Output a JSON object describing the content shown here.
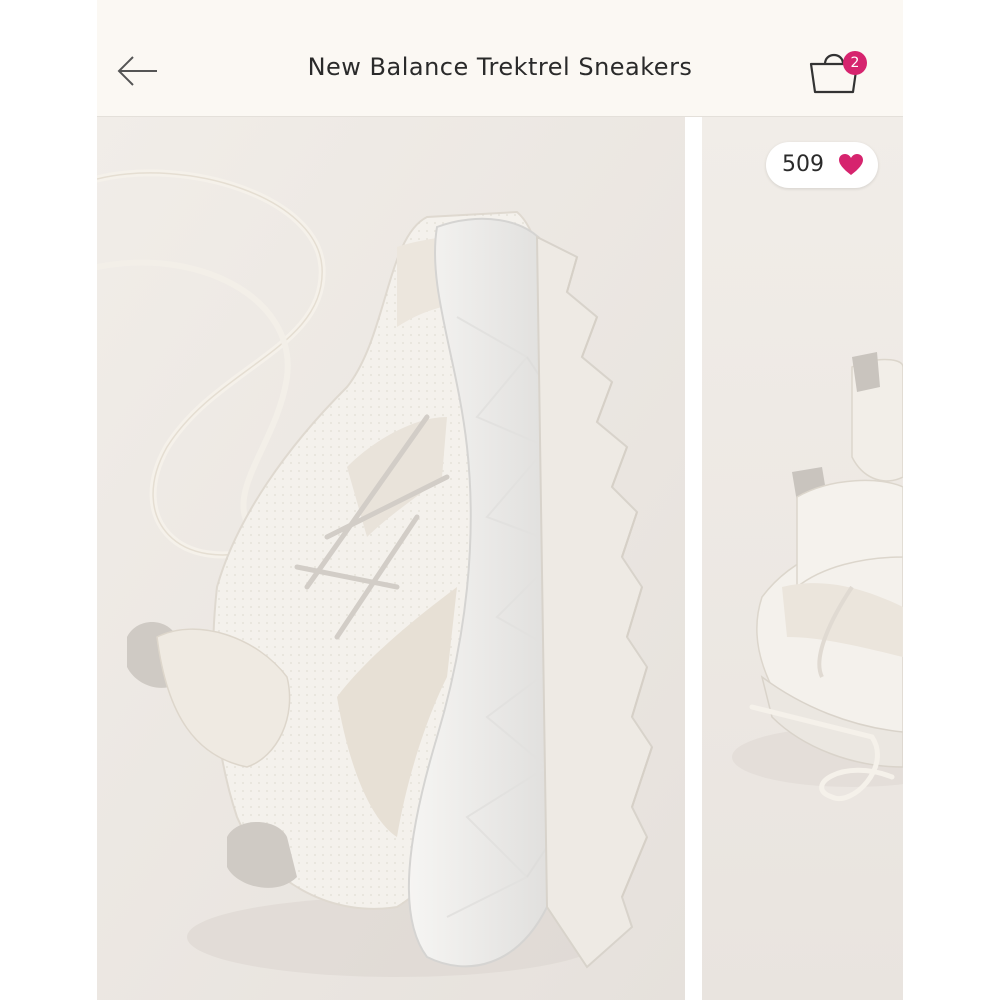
{
  "header": {
    "title": "New Balance Trektrel Sneakers",
    "back_icon": "arrow-left-icon",
    "bag_icon": "shopping-bag-icon",
    "bag_count": "2"
  },
  "gallery": {
    "likes_count": "509",
    "likes_icon": "heart-icon",
    "photos": [
      {
        "alt": "Off-white New Balance Trektrel sneaker, side view"
      },
      {
        "alt": "Pair of off-white sneakers, partial view"
      }
    ]
  },
  "colors": {
    "accent": "#d6246e",
    "header_bg": "#fbf8f3",
    "photo_bg": "#ede8e3",
    "title_text": "#2a2a2a"
  }
}
